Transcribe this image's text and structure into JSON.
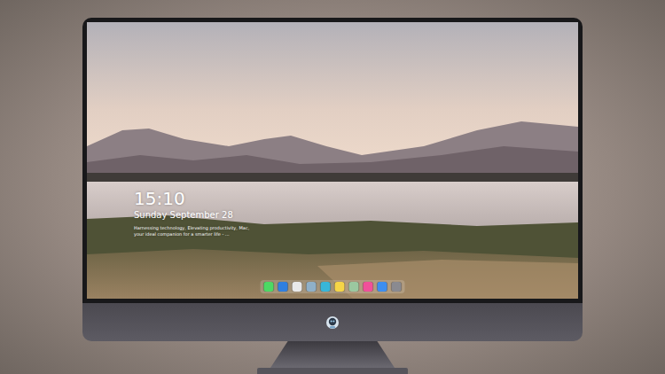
{
  "lockscreen": {
    "time": "15:10",
    "date": "Sunday September 28",
    "tagline": [
      "Harnessing technology, Elevating productivity, Mac,",
      "your ideal companion for a smarter life - ..."
    ]
  },
  "dock": {
    "items": [
      {
        "color": "#4cd964"
      },
      {
        "color": "#2f7fe0"
      },
      {
        "color": "#e9e9ea"
      },
      {
        "color": "#8fb0c8"
      },
      {
        "color": "#38b6d8"
      },
      {
        "color": "#f5d547"
      },
      {
        "color": "#9bc8a0"
      },
      {
        "color": "#f0509a"
      },
      {
        "color": "#3d8ef0"
      },
      {
        "color": "#8a8a90"
      }
    ]
  }
}
